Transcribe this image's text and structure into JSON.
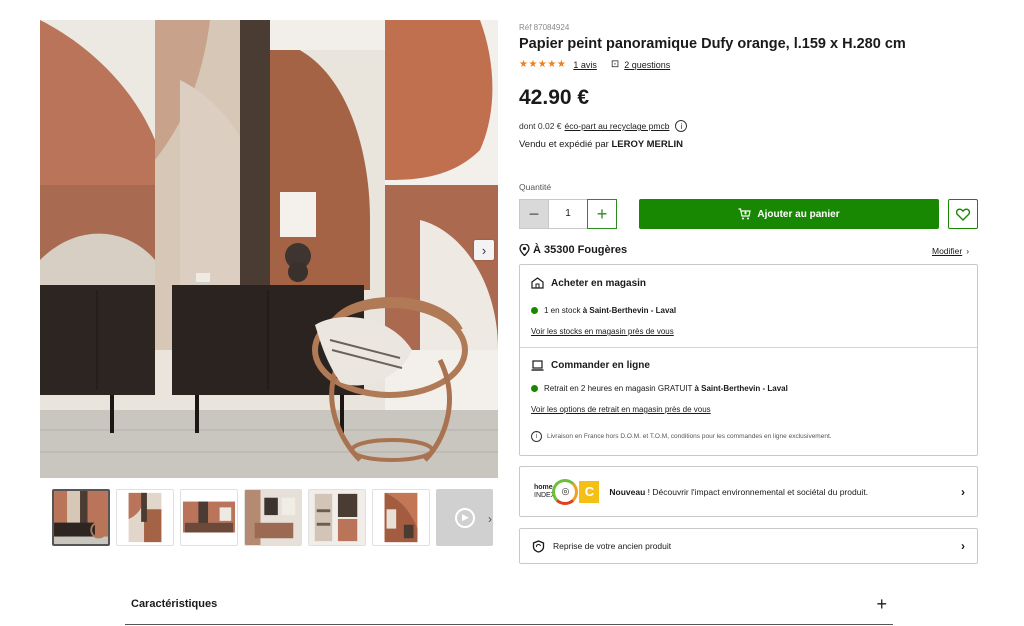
{
  "product": {
    "ref": "Réf 87084924",
    "title": "Papier peint panoramique Dufy orange, l.159 x H.280 cm",
    "stars": "★★★★★",
    "reviews_link": "1 avis",
    "questions_link": "2 questions",
    "price": "42.90 €",
    "eco_prefix": "dont 0.02 €",
    "eco_link": "éco-part au recyclage pmcb",
    "seller_prefix": "Vendu et expédié par",
    "seller_name": "LEROY MERLIN"
  },
  "purchase": {
    "qty_label": "Quantité",
    "qty_value": "1",
    "add_to_cart": "Ajouter au panier"
  },
  "location": {
    "label": "À 35300 Fougères",
    "modify": "Modifier"
  },
  "store": {
    "title": "Acheter en magasin",
    "stock_prefix": "1 en stock",
    "stock_store": "à Saint-Berthevin - Laval",
    "stock_link": "Voir les stocks en magasin près de vous"
  },
  "online": {
    "title": "Commander en ligne",
    "pickup_prefix": "Retrait en 2 heures en magasin GRATUIT",
    "pickup_store": "à Saint-Berthevin - Laval",
    "pickup_link": "Voir les options de retrait en magasin près de vous",
    "delivery_note": "Livraison en France hors D.O.M. et T.O.M, conditions pour les commandes en ligne exclusivement."
  },
  "home_index": {
    "logo_line1": "home",
    "logo_line2": "INDEX",
    "grade": "C",
    "bold": "Nouveau",
    "text": " ! Découvrir l'impact environnemental et sociétal du produit."
  },
  "reprise": {
    "text": "Reprise de votre ancien produit"
  },
  "characteristics": {
    "title": "Caractéristiques"
  },
  "colors": {
    "green": "#188803",
    "star": "#f07e1a",
    "grade_c": "#f4c016"
  },
  "icons": [
    "chevron-right-icon",
    "comment-icon",
    "info-icon",
    "cart-icon",
    "heart-icon",
    "location-pin-icon",
    "store-icon",
    "laptop-icon",
    "recycle-shield-icon",
    "play-icon",
    "plus-icon"
  ]
}
